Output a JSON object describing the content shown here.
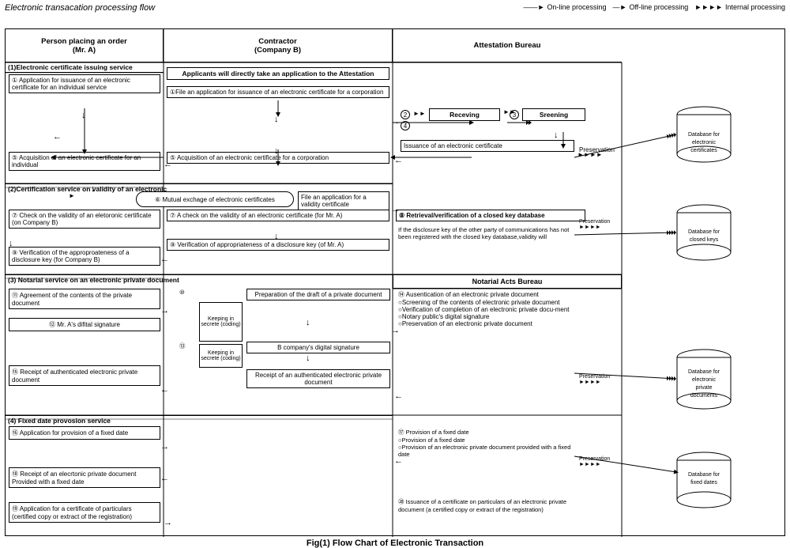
{
  "title": "Electronic transacation processing flow",
  "legend": {
    "online": "On-line processing",
    "offline": "Off-line processing",
    "internal": "Internal processing"
  },
  "caption": "Fig(1) Flow Chart of Electronic Transaction",
  "columns": {
    "person": "Person placing an order\n(Mr. A)",
    "contractor": "Contractor\n(Company B)",
    "attestation": "Attestation Bureau"
  },
  "section1": {
    "label": "(1)Electronic certificate issuing service",
    "steps": [
      "① Application for issuance of an electronic certificate for an individual service",
      "⑤ Acquisition of an electronic certificate for an individual"
    ],
    "middle": [
      "Applicants will directly take an application to the Attestation",
      "①File an application for issuance of an electronic certificate for a corporation",
      "⑤ Acquisition of an electronic certificate for a corporation"
    ],
    "right": [
      "② Receving",
      "③ Sreening",
      "④ Issuance of an electronic certificate",
      "Preservation"
    ]
  },
  "section2": {
    "label": "(2)Certification service on validity of an electronic",
    "steps": [
      "⑥ Mutual exchage of electronic certificates",
      "⑦ Check on the validity of an eletoronic certificate (on Company B)",
      "⑨ Verification of the approproateness of a disclosure key (for Company B)"
    ],
    "middle": [
      "File an application for a validity certificate",
      "⑦ A check on the validity of an electronic certificate (for Mr. A)",
      "⑨ Verification of appropriateness of a disclosure key (of Mr. A)"
    ],
    "right": [
      "⑧ Retrieval/verification of a closed key database",
      "If the disclosure key of the other party of communications has not been registered with the closed key database,validity will"
    ]
  },
  "section3": {
    "label": "(3) Notarial service on an electronic private document",
    "steps": [
      "⑪ Agreement of the contents of the private document",
      "⑫ Mr. A's difital signature",
      "⑮ Receipt of authenticated electronic private document"
    ],
    "middle": [
      "⑩ Preparation of the draft of a private document",
      "⑬ B company's digital signature",
      "⑮ Receipt of an authenticated electronic private document"
    ],
    "right": [
      "⑭ Ausentication of an electronic private document",
      "○Screening of the contents of electronic private document",
      "○Verification of completion of an electronic private document",
      "○Notary public's digital signature",
      "○Preservation of an electronic private document",
      "Preservation"
    ],
    "bureau": "Notarial Acts Bureau"
  },
  "section4": {
    "label": "(4) Fixed date provosion service",
    "steps": [
      "⑯ Application for provision of a fixed date",
      "⑱ Receipt of an elecrtonic private document Provided with a fixed date",
      "⑲ Application for a certificate of particulars (certified copy or extract of the registration)"
    ],
    "right": [
      "⑰ Provision of a fixed date",
      "○Provision of a fixed date",
      "○Provision of an electronic private document provided with a fixed date",
      "Preservation",
      "⑳ Issuance of a certificate on particulars of an electronic private document (a certified copy or extract of the registration)"
    ]
  },
  "databases": [
    "Database for electronic certificates",
    "Database for closed keys",
    "Database for electronic private documents",
    "Database for fixed dates"
  ]
}
